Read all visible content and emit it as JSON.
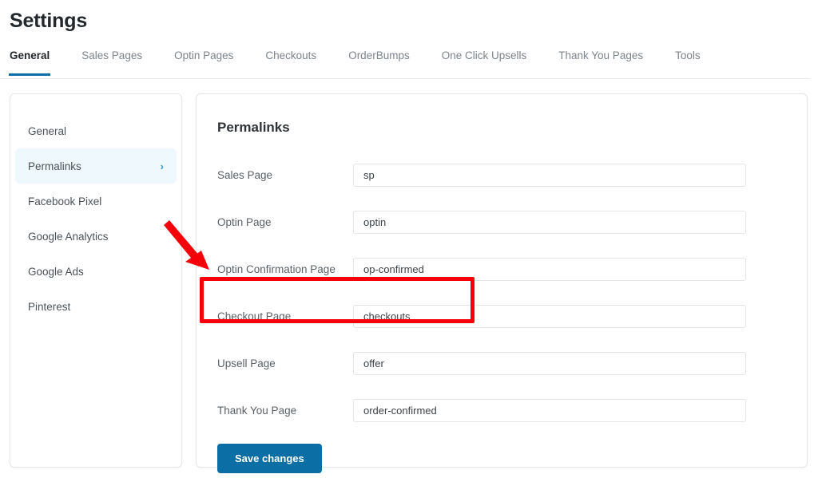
{
  "page": {
    "title": "Settings"
  },
  "tabs": [
    {
      "label": "General",
      "active": true
    },
    {
      "label": "Sales Pages",
      "active": false
    },
    {
      "label": "Optin Pages",
      "active": false
    },
    {
      "label": "Checkouts",
      "active": false
    },
    {
      "label": "OrderBumps",
      "active": false
    },
    {
      "label": "One Click Upsells",
      "active": false
    },
    {
      "label": "Thank You Pages",
      "active": false
    },
    {
      "label": "Tools",
      "active": false
    }
  ],
  "sidebar": {
    "items": [
      {
        "label": "General",
        "active": false,
        "chevron": ""
      },
      {
        "label": "Permalinks",
        "active": true,
        "chevron": "›"
      },
      {
        "label": "Facebook Pixel",
        "active": false,
        "chevron": ""
      },
      {
        "label": "Google Analytics",
        "active": false,
        "chevron": ""
      },
      {
        "label": "Google Ads",
        "active": false,
        "chevron": ""
      },
      {
        "label": "Pinterest",
        "active": false,
        "chevron": ""
      }
    ]
  },
  "main": {
    "title": "Permalinks",
    "fields": [
      {
        "label": "Sales Page",
        "value": "sp",
        "placeholder": "sp",
        "highlighted": false
      },
      {
        "label": "Optin Page",
        "value": "optin",
        "placeholder": "optin",
        "highlighted": false
      },
      {
        "label": "Optin Confirmation Page",
        "value": "op-confirmed",
        "placeholder": "op-confirmed",
        "highlighted": false
      },
      {
        "label": "Checkout Page",
        "value": "checkouts",
        "placeholder": "checkouts",
        "highlighted": true
      },
      {
        "label": "Upsell Page",
        "value": "offer",
        "placeholder": "offer",
        "highlighted": false
      },
      {
        "label": "Thank You Page",
        "value": "order-confirmed",
        "placeholder": "order-confirmed",
        "highlighted": false
      }
    ],
    "save_label": "Save changes"
  },
  "annotations": {
    "arrow_color": "#f5000a",
    "box_color": "#f5000a",
    "target_field": "Checkout Page"
  },
  "colors": {
    "accent": "#0b6ea4",
    "active_tab_underline": "#0b6ea4",
    "sidebar_active_bg": "#eff8fc",
    "sidebar_chevron": "#2c9ad6",
    "annotation_red": "#f5000a"
  }
}
